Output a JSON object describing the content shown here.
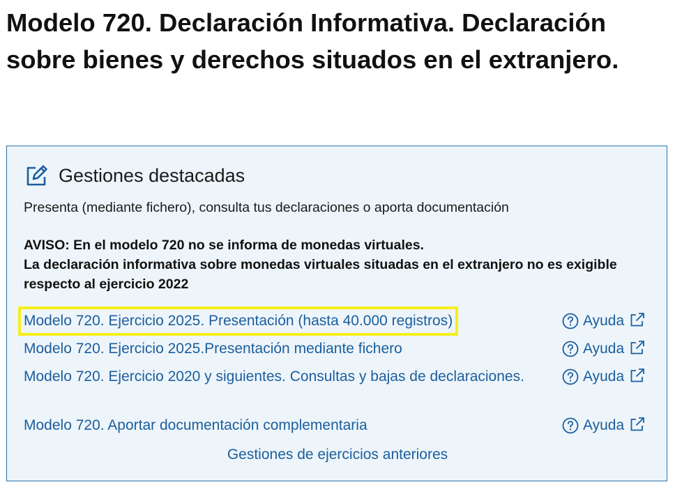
{
  "page": {
    "title": "Modelo 720. Declaración Informativa. Declaración sobre bienes y derechos situados en el extranjero."
  },
  "panel": {
    "icon": "edit-icon",
    "heading": "Gestiones destacadas",
    "subtitle": "Presenta (mediante fichero), consulta tus declaraciones o aporta documentación",
    "notice": {
      "line1": "AVISO: En el modelo 720 no se informa de monedas virtuales.",
      "line2": "La declaración informativa sobre monedas virtuales situadas en el extranjero no es exigible respecto al ejercicio 2022"
    },
    "procedures": [
      {
        "label": "Modelo 720. Ejercicio 2025. Presentación (hasta 40.000 registros)",
        "help": "Ayuda",
        "highlighted": true
      },
      {
        "label": "Modelo 720. Ejercicio 2025.Presentación mediante fichero",
        "help": "Ayuda",
        "highlighted": false
      },
      {
        "label": "Modelo 720. Ejercicio 2020 y siguientes. Consultas y bajas de declaraciones.",
        "help": "Ayuda",
        "highlighted": false
      },
      {
        "label": "Modelo 720. Aportar documentación complementaria",
        "help": "Ayuda",
        "highlighted": false
      }
    ],
    "previous_years_link": "Gestiones de ejercicios anteriores"
  },
  "colors": {
    "link": "#1b5e9e",
    "panel_background": "#eef5fa",
    "panel_border": "#2a6fa8",
    "highlight_outline": "#f5ee1c"
  }
}
